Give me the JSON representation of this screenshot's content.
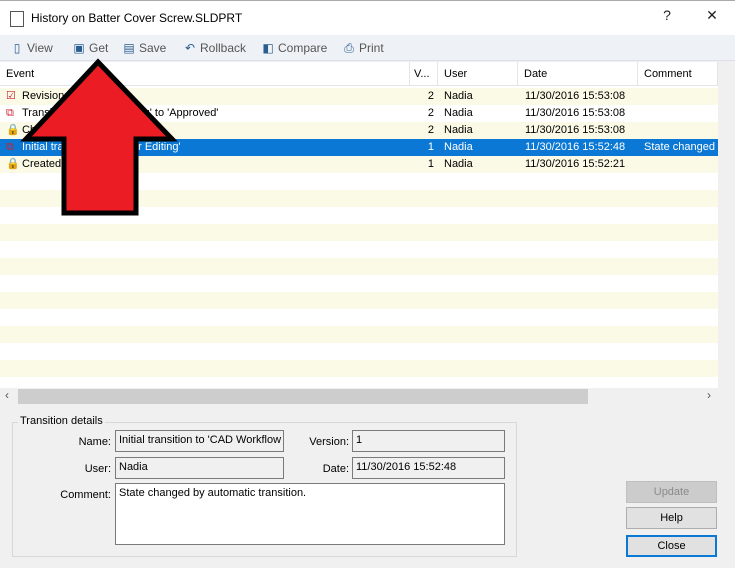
{
  "window": {
    "title": "History on Batter Cover Screw.SLDPRT",
    "help": "?",
    "close": "✕"
  },
  "toolbar": [
    {
      "label": "View",
      "icon": "view-icon"
    },
    {
      "label": "Get",
      "icon": "get-icon"
    },
    {
      "label": "Save",
      "icon": "save-icon"
    },
    {
      "label": "Rollback",
      "icon": "rollback-icon"
    },
    {
      "label": "Compare",
      "icon": "compare-icon"
    },
    {
      "label": "Print",
      "icon": "print-icon"
    }
  ],
  "columns": {
    "event": "Event",
    "version": "V...",
    "user": "User",
    "date": "Date",
    "comment": "Comment"
  },
  "rows": [
    {
      "event_a": "Revision:",
      "event_b": "",
      "version": "2",
      "user": "Nadia",
      "date": "11/30/2016 15:53:08",
      "comment": "",
      "icon": "revision-check-icon"
    },
    {
      "event_a": "Transi",
      "event_b": "ting' to 'Approved'",
      "version": "2",
      "user": "Nadia",
      "date": "11/30/2016 15:53:08",
      "comment": "",
      "icon": "transition-icon"
    },
    {
      "event_a": "Ch",
      "event_b": "",
      "version": "2",
      "user": "Nadia",
      "date": "11/30/2016 15:53:08",
      "comment": "",
      "icon": "checkin-lock-icon"
    },
    {
      "event_a": "Initial tra",
      "event_b": "er Editing'",
      "version": "1",
      "user": "Nadia",
      "date": "11/30/2016 15:52:48",
      "comment": "State changed",
      "icon": "transition-icon",
      "selected": true
    },
    {
      "event_a": "Created",
      "event_b": "",
      "version": "1",
      "user": "Nadia",
      "date": "11/30/2016 15:52:21",
      "comment": "",
      "icon": "created-lock-icon"
    }
  ],
  "details": {
    "group_title": "Transition details",
    "name_label": "Name:",
    "name": "Initial transition to 'CAD Workflow",
    "version_label": "Version:",
    "version": "1",
    "user_label": "User:",
    "user": "Nadia",
    "date_label": "Date:",
    "date": "11/30/2016 15:52:48",
    "comment_label": "Comment:",
    "comment": "State changed by automatic transition."
  },
  "buttons": {
    "update": "Update",
    "help": "Help",
    "close": "Close"
  },
  "colors": {
    "selection": "#0a78d4",
    "stripe": "#fafae6",
    "arrow": "#ec1c24"
  }
}
